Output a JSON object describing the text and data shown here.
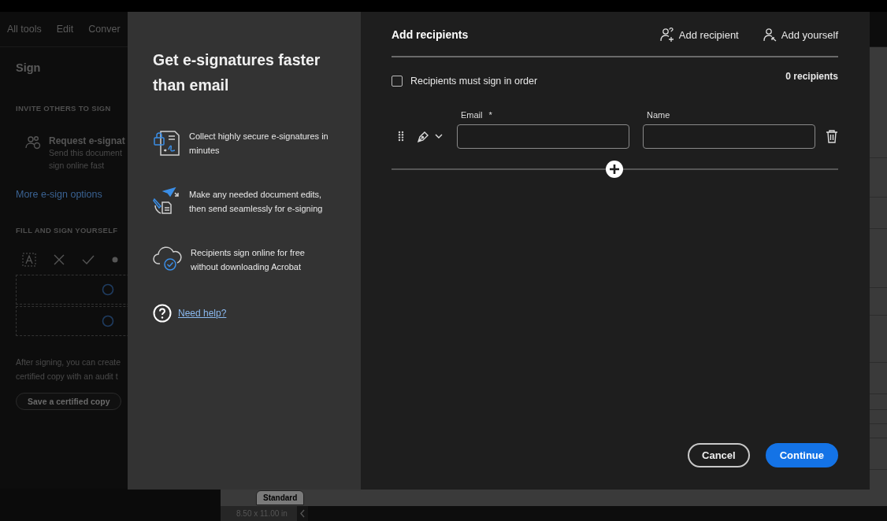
{
  "app": {
    "toolbar_tabs": [
      "All tools",
      "Edit",
      "Conver"
    ],
    "sidebar": {
      "title": "Sign",
      "invite_heading": "INVITE OTHERS TO SIGN",
      "request": {
        "title": "Request e-signat",
        "description": "Send this document",
        "description_2": "sign online fast"
      },
      "more_link": "More e-sign options",
      "fill_heading": "FILL AND SIGN YOURSELF",
      "note": "After signing, you can create",
      "note_2": "certified copy with an audit t",
      "save_button": "Save a certified copy"
    },
    "document": {
      "label": "Standard",
      "page_size": "8.50 x 11.00 in"
    }
  },
  "dialog": {
    "promo": {
      "title": "Get e-signatures faster than email",
      "features": [
        {
          "kind": "secure",
          "text": "Collect highly secure e-signatures in minutes"
        },
        {
          "kind": "edit",
          "text": "Make any needed document edits, then send seamlessly for e-signing"
        },
        {
          "kind": "cloud",
          "text": "Recipients sign online for free without downloading Acrobat"
        }
      ],
      "help_link": "Need help?"
    },
    "title": "Add recipients",
    "actions": [
      {
        "kind": "add-recipient",
        "label": "Add recipient"
      },
      {
        "kind": "add-yourself",
        "label": "Add yourself"
      }
    ],
    "sign_in_order": {
      "label": "Recipients must sign in order",
      "checked": false
    },
    "recipient_count": "0 recipients",
    "recipients": [
      {
        "email_label": "Email",
        "required_mark": "*",
        "name_label": "Name"
      }
    ],
    "buttons": [
      {
        "kind": "secondary",
        "label": "Cancel"
      },
      {
        "kind": "primary",
        "label": "Continue"
      }
    ]
  }
}
